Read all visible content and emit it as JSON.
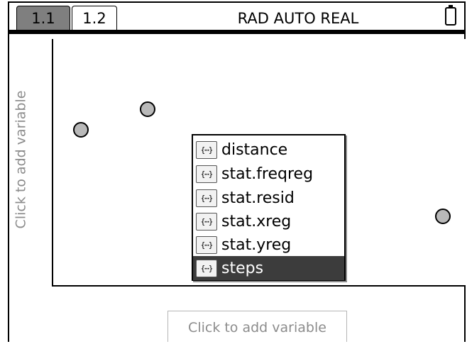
{
  "tabs": [
    {
      "label": "1.1",
      "active": true
    },
    {
      "label": "1.2",
      "active": false
    }
  ],
  "status": {
    "mode_text": "RAD AUTO REAL"
  },
  "axes": {
    "y_placeholder": "Click to add variable",
    "x_placeholder": "Click to add variable"
  },
  "variable_menu": {
    "icon_glyph": "{⋯}",
    "items": [
      "distance",
      "stat.freqreg",
      "stat.resid",
      "stat.xreg",
      "stat.yreg",
      "steps"
    ],
    "selected": "steps"
  },
  "colors": {
    "active_tab": "#7f7f7f",
    "selection": "#3c3c3c",
    "point_fill": "#b9b9b9"
  }
}
